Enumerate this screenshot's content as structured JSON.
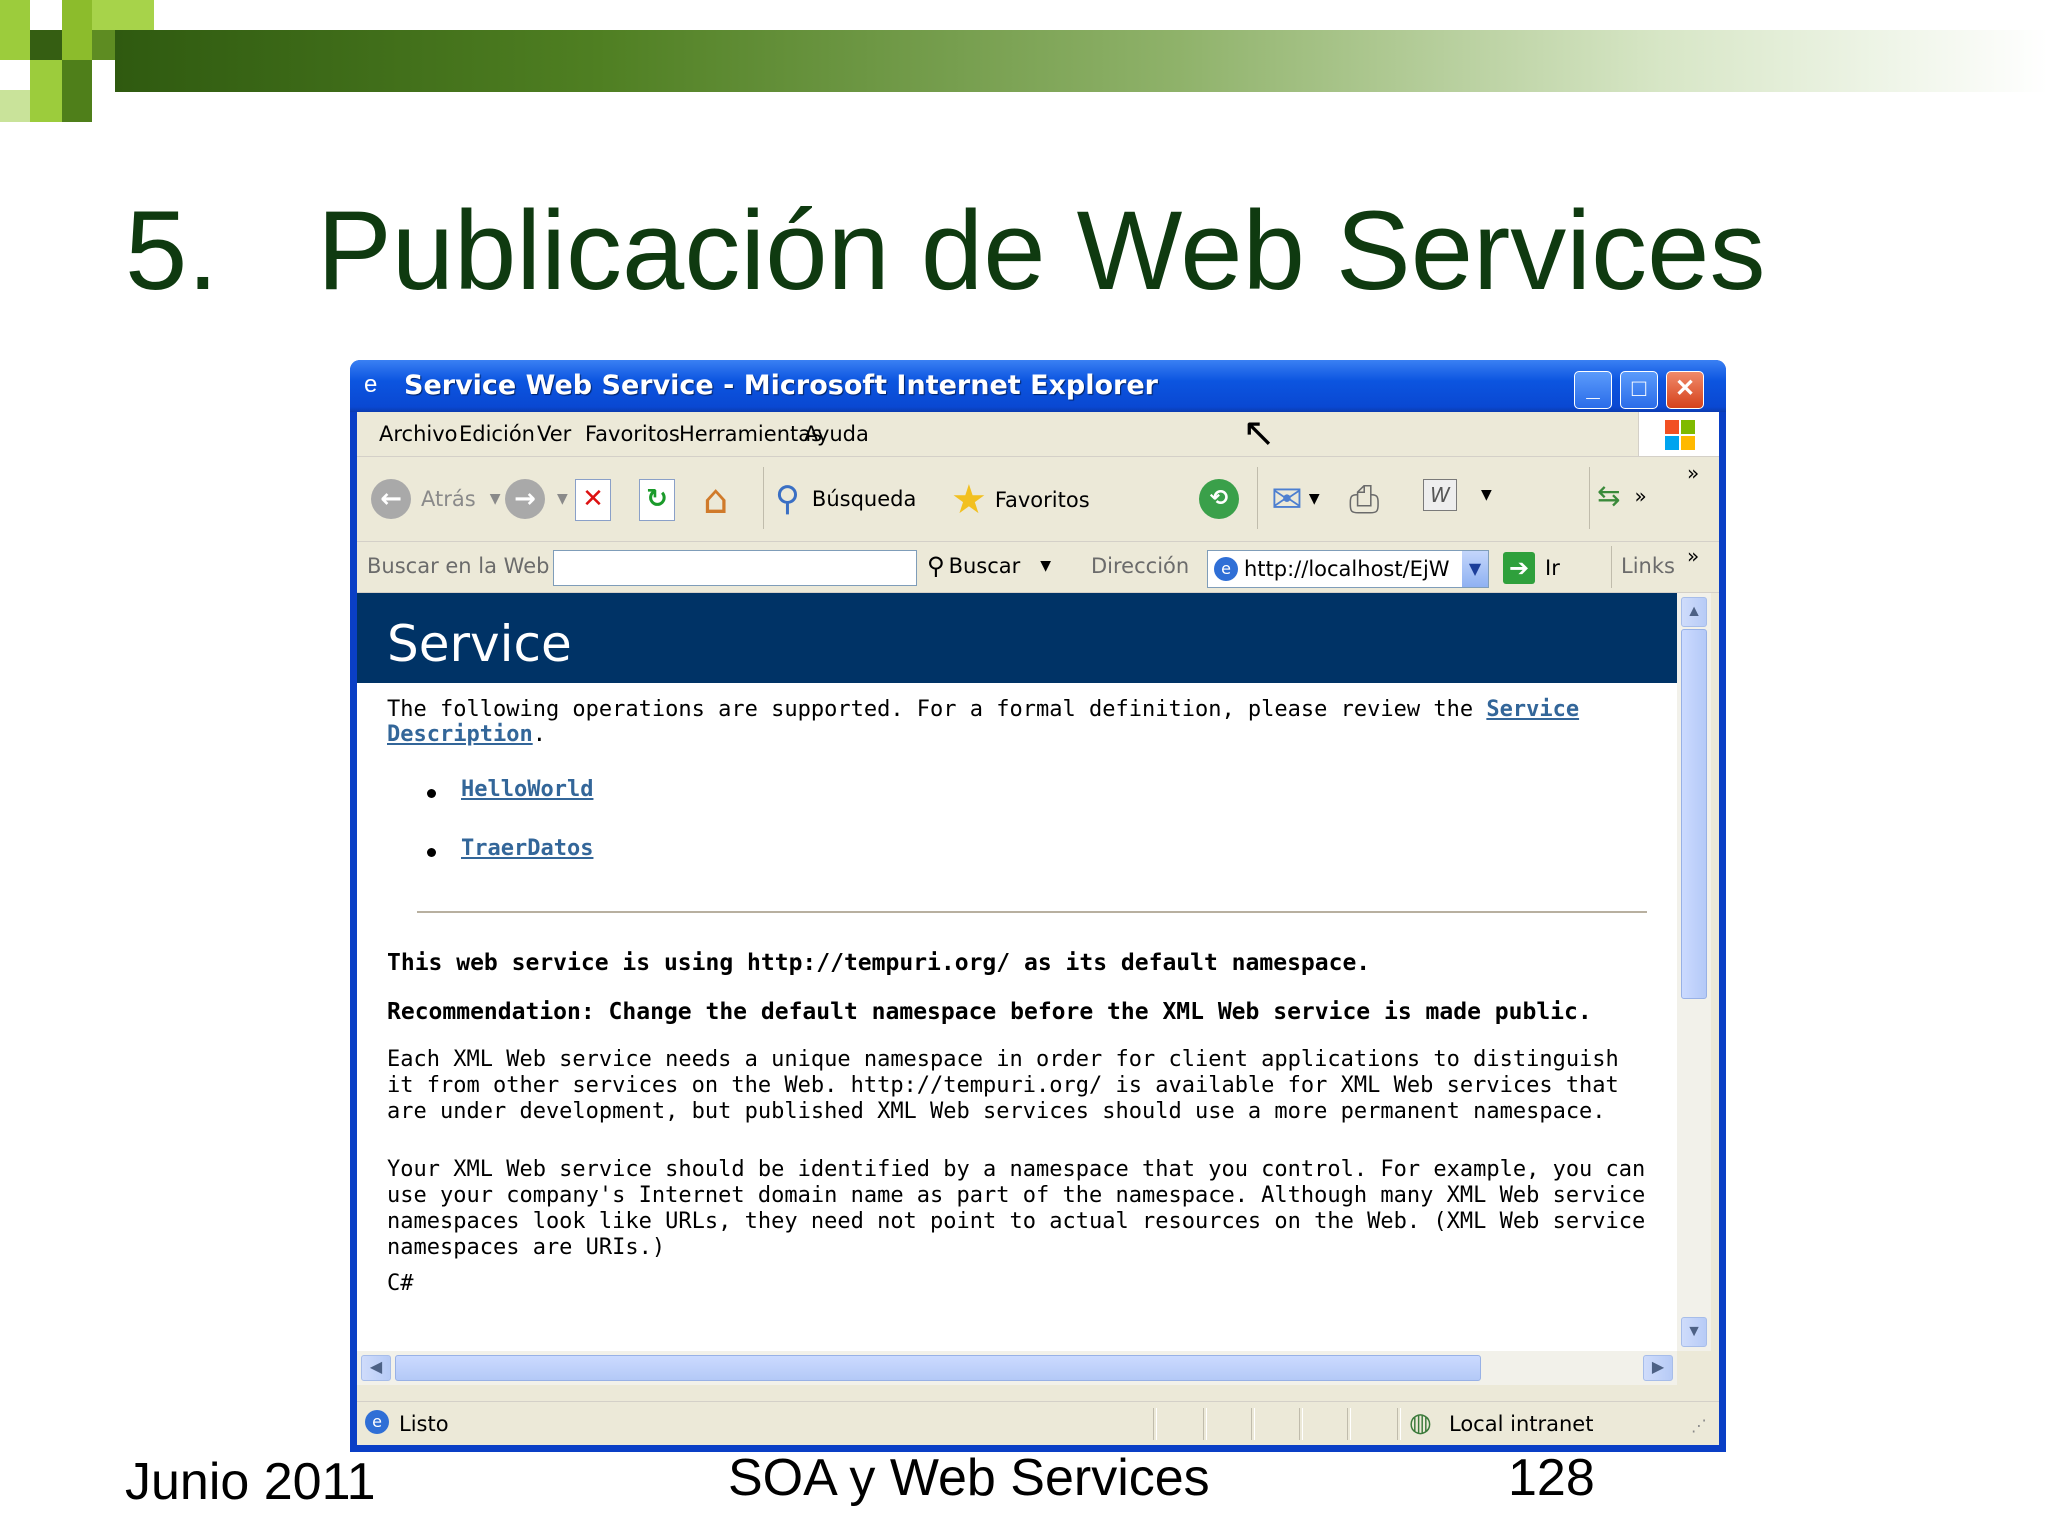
{
  "slide": {
    "number": "5.",
    "title": "Publicación de Web Services",
    "footer_left": "Junio 2011",
    "footer_center": "SOA y Web Services",
    "footer_right": "128"
  },
  "window": {
    "title": "Service Web Service - Microsoft Internet Explorer",
    "menu": [
      "Archivo",
      "Edición",
      "Ver",
      "Favoritos",
      "Herramientas",
      "Ayuda"
    ],
    "toolbar": {
      "back": "Atrás",
      "search": "Búsqueda",
      "favorites": "Favoritos"
    },
    "addressbar": {
      "search_label": "Buscar en la Web",
      "search_value": "",
      "search_button": "Buscar",
      "address_label": "Dirección",
      "url": "http://localhost/EjW",
      "go": "Ir",
      "links": "Links"
    },
    "status": {
      "text": "Listo",
      "zone": "Local intranet"
    }
  },
  "content": {
    "header": "Service",
    "intro_prefix": "The following operations are supported. For a formal definition, please review the ",
    "intro_link": "Service Description",
    "intro_suffix": ".",
    "operations": [
      "HelloWorld",
      "TraerDatos"
    ],
    "namespace_note": "This web service is using http://tempuri.org/ as its default namespace.",
    "recommendation": "Recommendation: Change the default namespace before the XML Web service is made public.",
    "para1": "Each XML Web service needs a unique namespace in order for client applications to distinguish it from other services on the Web. http://tempuri.org/ is available for XML Web services that are under development, but published XML Web services should use a more permanent namespace.",
    "para2": "Your XML Web service should be identified by a namespace that you control. For example, you can use your company's Internet domain name as part of the namespace. Although many XML Web service namespaces look like URLs, they need not point to actual resources on the Web. (XML Web service namespaces are URIs.)",
    "code_label": "C#"
  },
  "icons": [
    "back-icon",
    "forward-icon",
    "stop-icon",
    "refresh-icon",
    "home-icon",
    "search-icon",
    "favorites-star-icon",
    "history-icon",
    "mail-icon",
    "print-icon",
    "edit-icon"
  ]
}
